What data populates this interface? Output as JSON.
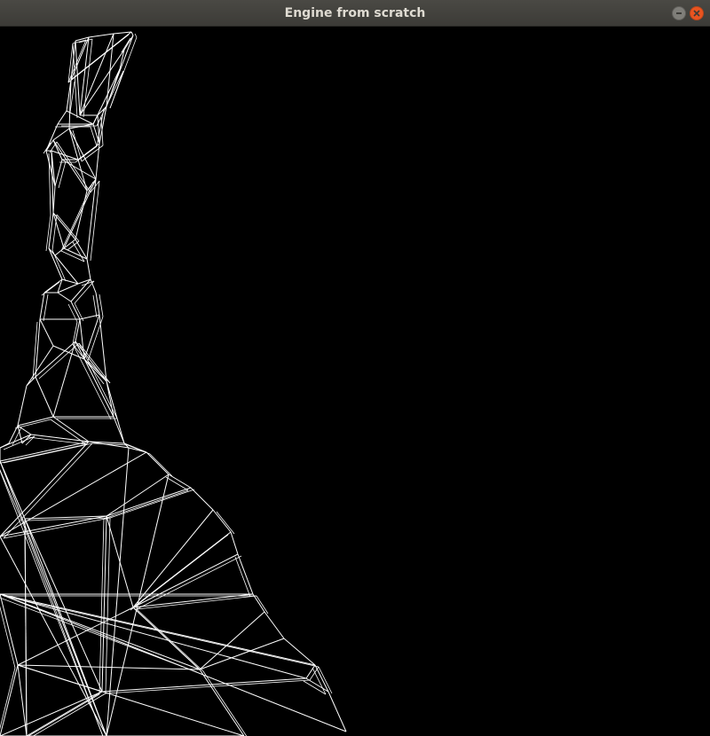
{
  "window": {
    "title": "Engine from scratch",
    "controls": [
      {
        "name": "minimize",
        "icon": "minimize-icon"
      },
      {
        "name": "close",
        "icon": "close-icon"
      }
    ]
  },
  "viewport": {
    "background": "#000000",
    "wire_color": "#ffffff",
    "content": "wireframe-mesh"
  }
}
